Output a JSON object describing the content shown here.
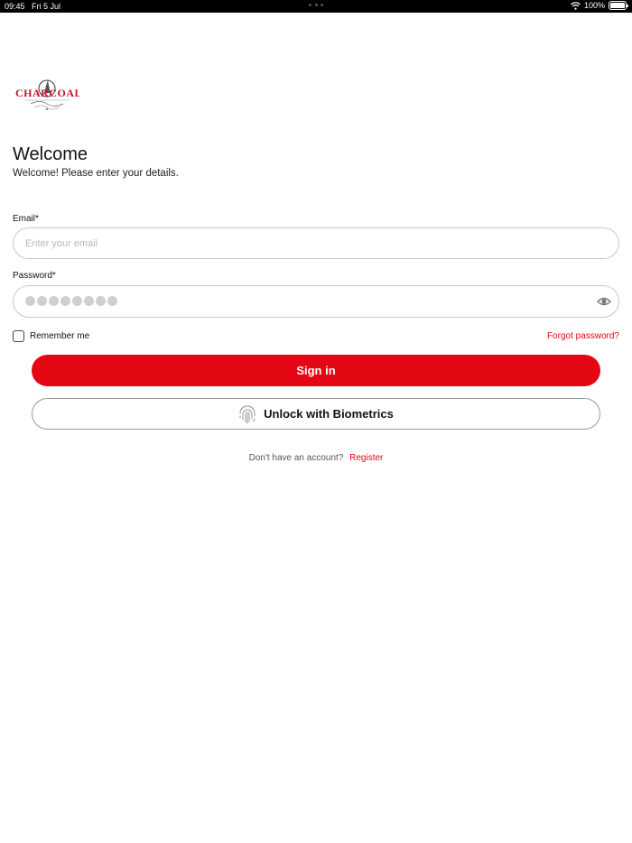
{
  "status_bar": {
    "time": "09:45",
    "date": "Fri 5 Jul",
    "battery": "100%"
  },
  "brand": {
    "logo_text": "CHARCOAL",
    "accent": "#e30613"
  },
  "heading": {
    "title": "Welcome",
    "subtitle": "Welcome! Please enter your details."
  },
  "email": {
    "label": "Email*",
    "placeholder": "Enter your email",
    "value": ""
  },
  "password": {
    "label": "Password*",
    "masked_length": 8,
    "visibility_icon": "eye-icon"
  },
  "remember": {
    "label": "Remember me",
    "checked": false
  },
  "forgot": {
    "label": "Forgot password?"
  },
  "buttons": {
    "sign_in": "Sign in",
    "biometrics": "Unlock with Biometrics",
    "biometrics_icon": "fingerprint-icon"
  },
  "register": {
    "prompt": "Don't have an account?",
    "link": "Register"
  }
}
